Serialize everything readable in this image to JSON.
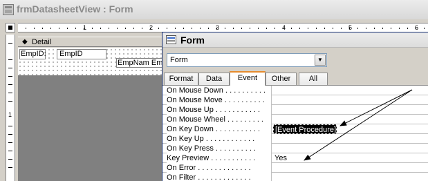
{
  "window": {
    "title": "frmDatasheetView : Form"
  },
  "ruler": {
    "top_numbers": [
      "1",
      "2",
      "3",
      "4",
      "5",
      "6"
    ],
    "left_numbers": [
      "1"
    ]
  },
  "section": {
    "label": "Detail"
  },
  "controls": {
    "label1": "EmpID:",
    "text1": "EmpID",
    "label2": "EmpNam EmpN"
  },
  "property_sheet": {
    "title": "Form",
    "selector_value": "Form",
    "tabs": [
      "Format",
      "Data",
      "Event",
      "Other",
      "All"
    ],
    "active_tab": "Event",
    "rows": [
      {
        "name": "On Mouse Down . . . . . . . . . .",
        "value": ""
      },
      {
        "name": "On Mouse Move . . . . . . . . . .",
        "value": ""
      },
      {
        "name": "On Mouse Up . . . . . . . . . . .",
        "value": ""
      },
      {
        "name": "On Mouse Wheel . . . . . . . . .",
        "value": ""
      },
      {
        "name": "On Key Down . . . . . . . . . . .",
        "value": "[Event Procedure]"
      },
      {
        "name": "On Key Up . . . . . . . . . . . .",
        "value": ""
      },
      {
        "name": "On Key Press . . . . . . . . . .",
        "value": ""
      },
      {
        "name": "Key Preview . . . . . . . . . . .",
        "value": "Yes"
      },
      {
        "name": "On Error . . . . . . . . . . . . .",
        "value": ""
      },
      {
        "name": "On Filter . . . . . . . . . . . . .",
        "value": ""
      }
    ]
  },
  "colors": {
    "active_tab_accent": "#e68b2c",
    "selected_bg": "#000000"
  }
}
